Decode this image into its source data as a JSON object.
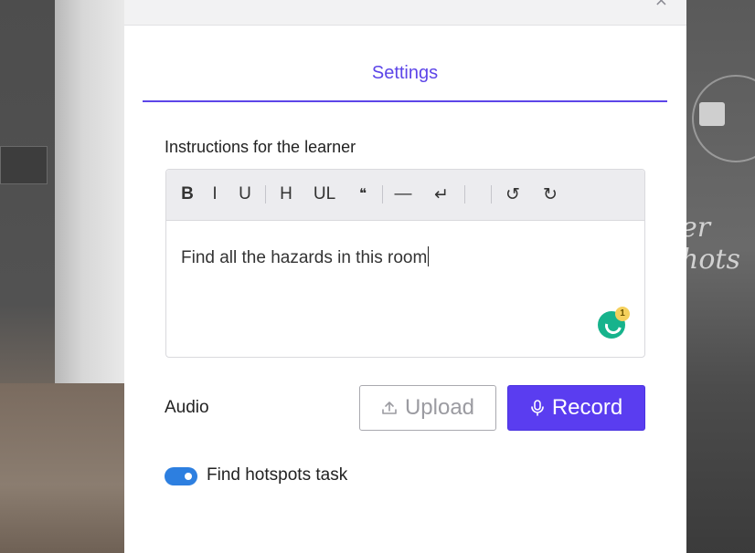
{
  "modal": {
    "close_glyph": "×",
    "tab_label": "Settings",
    "instructions_label": "Instructions for the learner",
    "editor": {
      "toolbar": {
        "bold": "B",
        "italic": "I",
        "underline": "U",
        "heading": "H",
        "list": "UL",
        "quote": "❝",
        "rule": "—",
        "linebreak": "↵",
        "undo": "↺",
        "redo": "↻"
      },
      "content": "Find all the hazards in this room",
      "grammarly_count": "1"
    },
    "audio_label": "Audio",
    "upload_label": "Upload",
    "record_label": "Record",
    "hotspots_label": "Find hotspots task",
    "hotspots_enabled": true
  },
  "background": {
    "hotspot_text": "er hots"
  },
  "colors": {
    "accent": "#5c45e8",
    "record_bg": "#5a3df0",
    "toggle_on": "#2d7fe0",
    "grammarly": "#17b38c"
  }
}
